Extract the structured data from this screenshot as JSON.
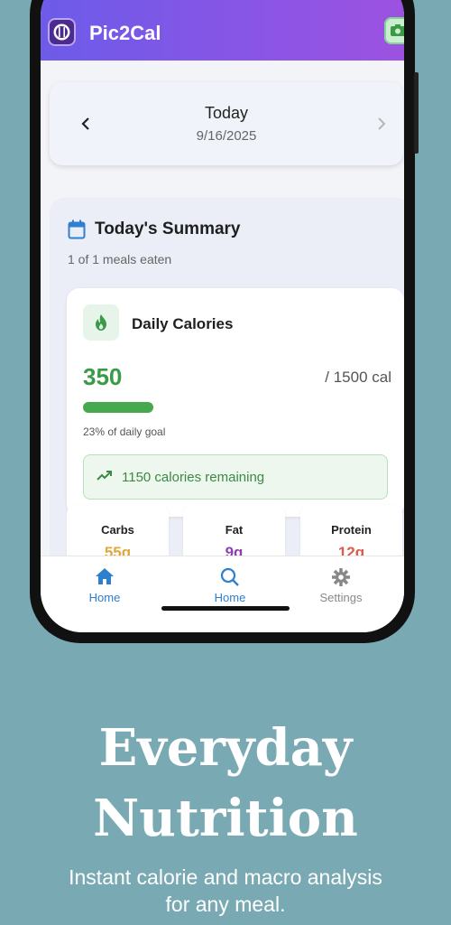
{
  "app": {
    "title": "Pic2Cal"
  },
  "date_card": {
    "title": "Today",
    "date": "9/16/2025"
  },
  "summary": {
    "title": "Today's Summary",
    "meals": "1 of 1 meals eaten",
    "calories": {
      "title": "Daily Calories",
      "value": "350",
      "goal": "/ 1500 cal",
      "percent_text": "23% of daily goal",
      "progress_fraction": 0.23,
      "remaining": "1150 calories remaining"
    },
    "macros": [
      {
        "label": "Carbs",
        "value": "55g",
        "color": "#e0a83a"
      },
      {
        "label": "Fat",
        "value": "9g",
        "color": "#8d3fb2"
      },
      {
        "label": "Protein",
        "value": "12g",
        "color": "#e05a4b"
      }
    ]
  },
  "nav": [
    {
      "label": "Home",
      "icon": "home-icon",
      "active": true
    },
    {
      "label": "Home",
      "icon": "search-icon",
      "active": true
    },
    {
      "label": "Settings",
      "icon": "gear-icon",
      "active": false
    }
  ],
  "promo": {
    "headline_1": "Everyday",
    "headline_2": "Nutrition",
    "tagline_1": "Instant calorie and macro analysis",
    "tagline_2": "for any meal."
  },
  "colors": {
    "background": "#79aab3",
    "accent": "#6d5be8",
    "green": "#3a9a46",
    "nav_active": "#2d7fd0"
  }
}
